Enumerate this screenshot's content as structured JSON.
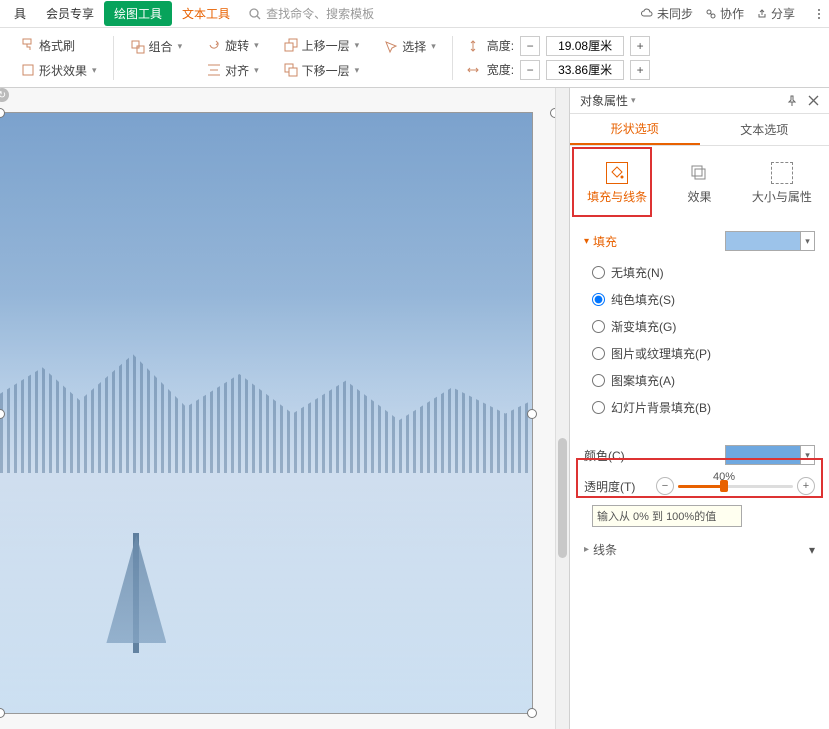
{
  "menubar": {
    "items": [
      "具",
      "会员专享",
      "绘图工具",
      "文本工具"
    ],
    "search_placeholder": "查找命令、搜索模板",
    "right": {
      "sync": "未同步",
      "collab": "协作",
      "share": "分享"
    }
  },
  "ribbon": {
    "format_painter": "格式刷",
    "shape_effect": "形状效果",
    "group": "组合",
    "rotate": "旋转",
    "align": "对齐",
    "move_up": "上移一层",
    "move_down": "下移一层",
    "select": "选择",
    "height_label": "高度:",
    "width_label": "宽度:",
    "height_value": "19.08厘米",
    "width_value": "33.86厘米"
  },
  "panel": {
    "title": "对象属性",
    "tabs": {
      "shape": "形状选项",
      "text": "文本选项"
    },
    "sub_tabs": {
      "fill": "填充与线条",
      "effect": "效果",
      "size": "大小与属性"
    },
    "fill_section": "填充",
    "fill_options": {
      "none": "无填充(N)",
      "solid": "纯色填充(S)",
      "gradient": "渐变填充(G)",
      "picture": "图片或纹理填充(P)",
      "pattern": "图案填充(A)",
      "slide_bg": "幻灯片背景填充(B)"
    },
    "color_label": "颜色(C)",
    "transparency_label": "透明度(T)",
    "transparency_value": "40%",
    "hint": "输入从 0% 到 100%的值",
    "line_section": "线条"
  }
}
